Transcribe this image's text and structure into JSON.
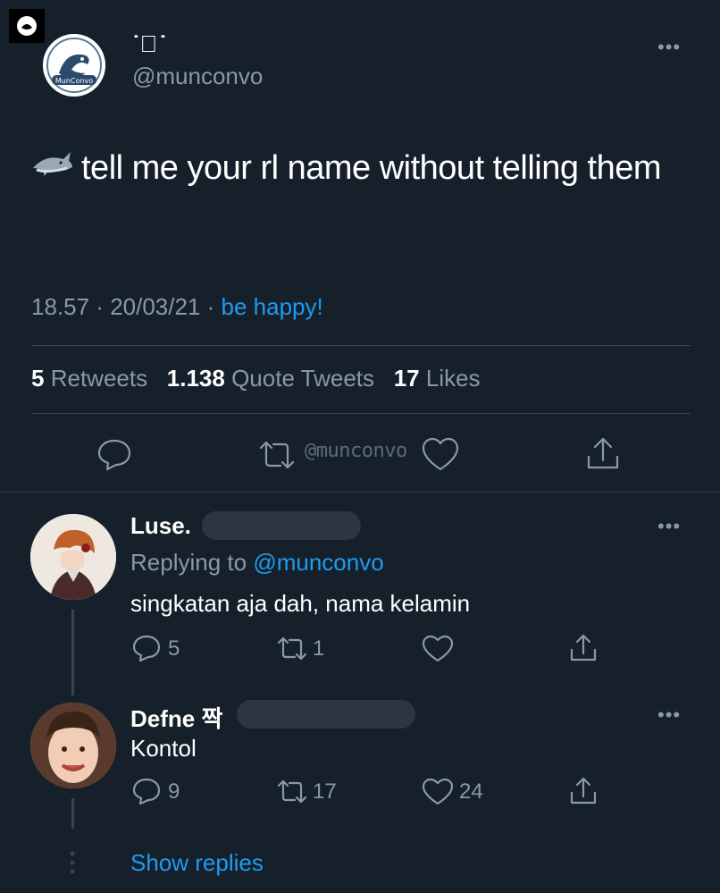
{
  "tweet": {
    "display_name": "˙ฺ˙",
    "handle": "@munconvo",
    "avatar_text": "MunConvo",
    "emoji": "shark-emoji",
    "text": "tell me your rl name without telling them",
    "time": "18.57",
    "date": "20/03/21",
    "source": "be happy!",
    "retweets": "5",
    "retweets_label": "Retweets",
    "quote_tweets": "1.138",
    "quote_tweets_label": "Quote Tweets",
    "likes": "17",
    "likes_label": "Likes",
    "watermark": "@munconvo"
  },
  "replies": [
    {
      "name": "Luse.",
      "replying_label": "Replying to",
      "replying_to": "@munconvo",
      "text": "singkatan aja dah, nama kelamin",
      "reply_count": "5",
      "retweet_count": "1",
      "like_count": ""
    },
    {
      "name": "Defne 짝",
      "text": "Kontol",
      "reply_count": "9",
      "retweet_count": "17",
      "like_count": "24"
    }
  ],
  "show_replies": "Show replies",
  "more_glyph": "•••",
  "colors": {
    "background": "#15202b",
    "link": "#1d9bf0",
    "muted": "#8b98a5",
    "divider": "#38444d"
  }
}
